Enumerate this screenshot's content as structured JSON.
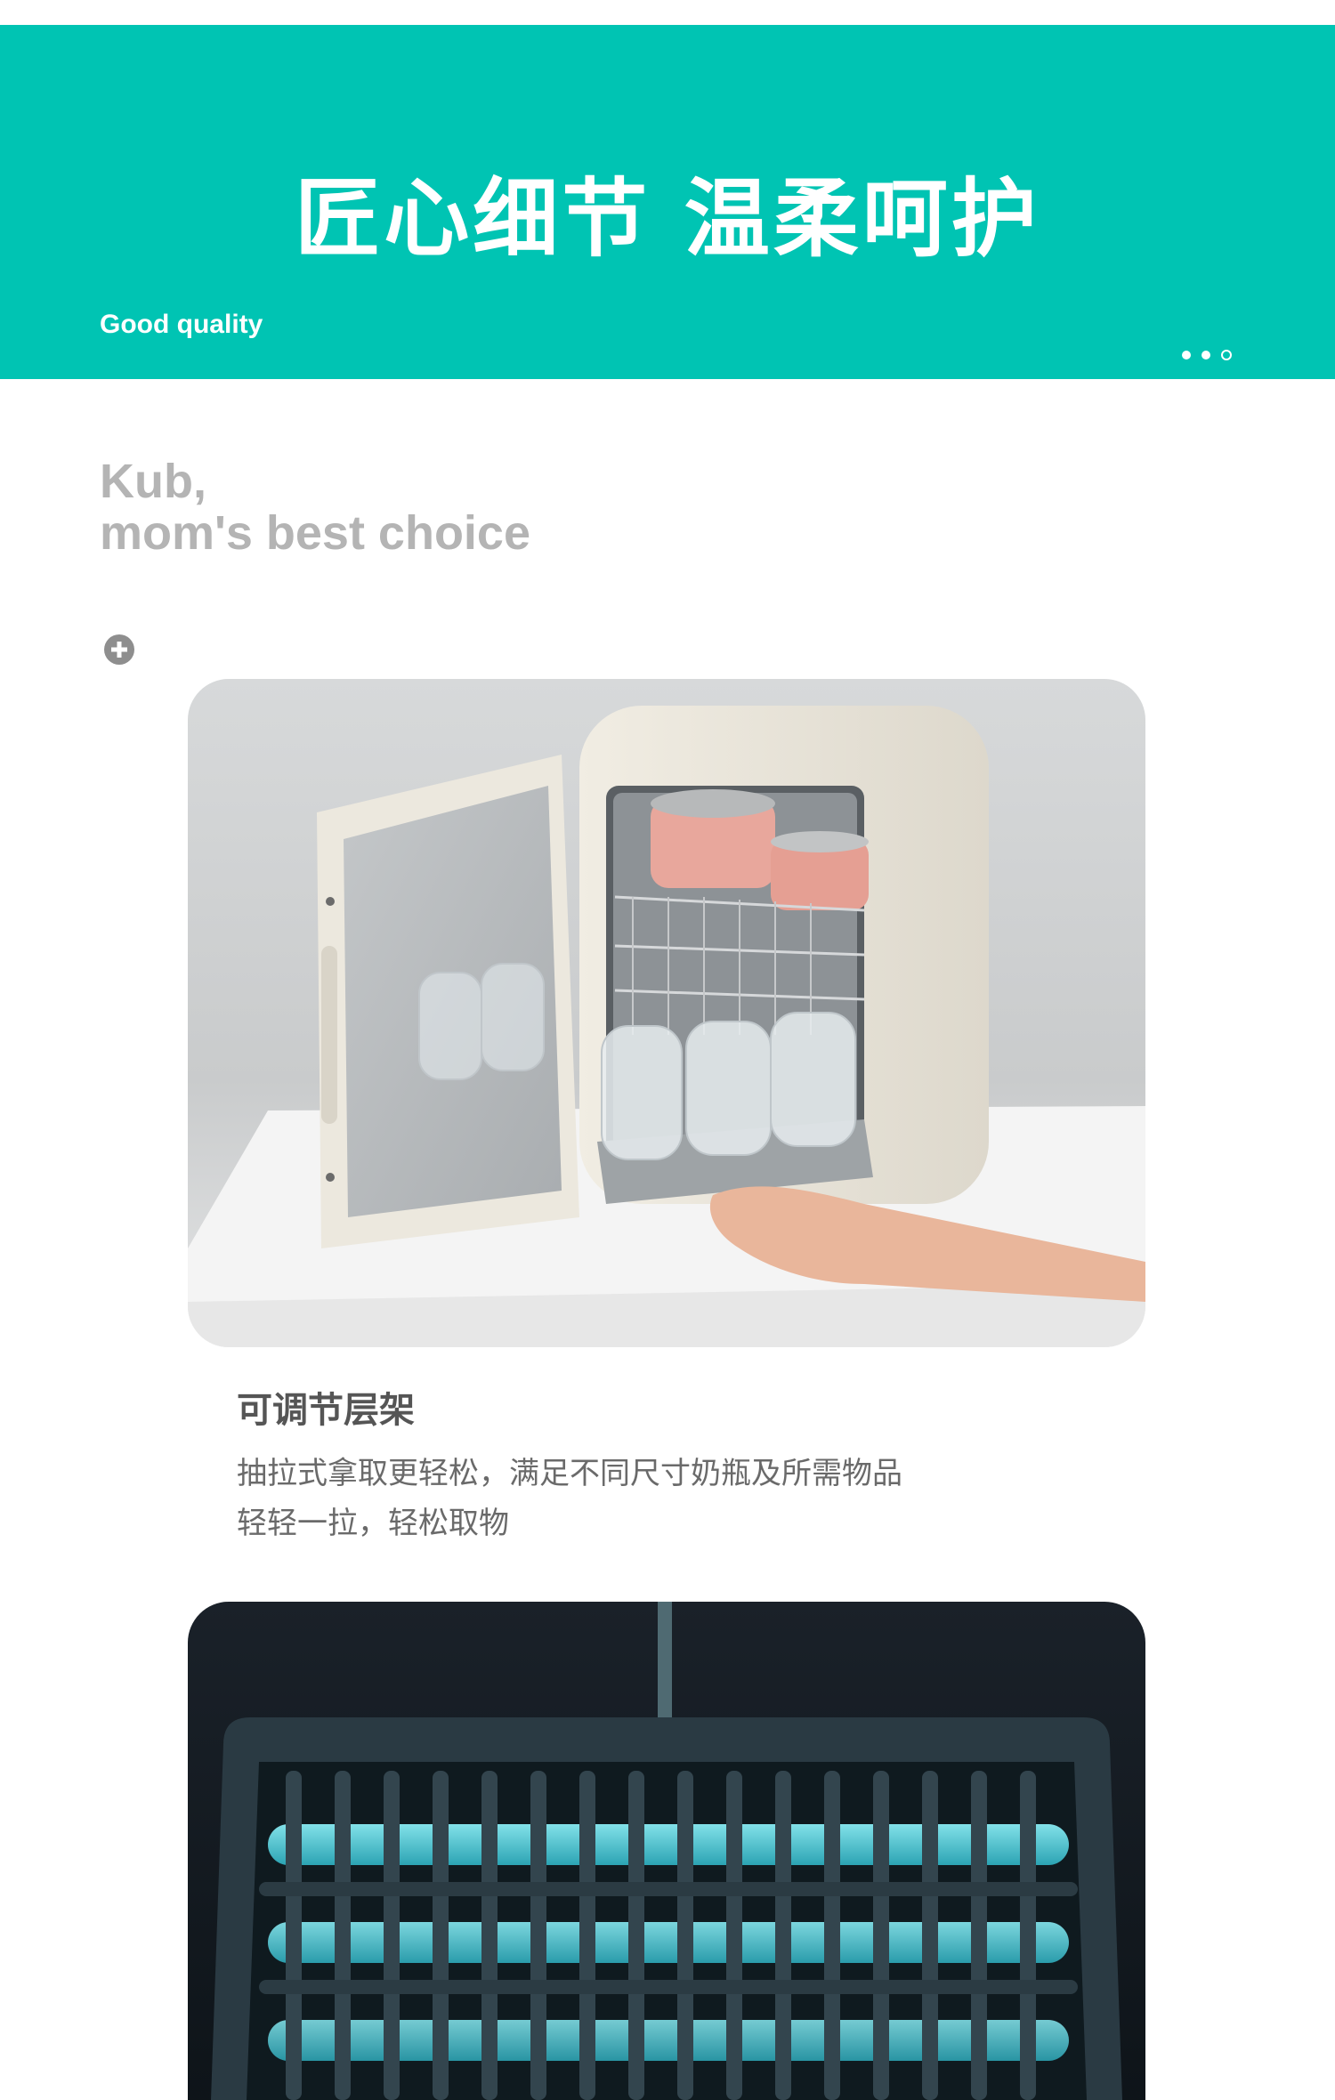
{
  "banner": {
    "title": "匠心细节 温柔呵护",
    "subtitle": "Good quality",
    "accent_color": "#00c4b3"
  },
  "slogan": {
    "line1": "Kub,",
    "line2": "mom's best choice"
  },
  "icons": {
    "expand": "plus-circle-icon"
  },
  "feature": {
    "title": "可调节层架",
    "desc_line1": "抽拉式拿取更轻松，满足不同尺寸奶瓶及所需物品",
    "desc_line2": "轻轻一拉，轻松取物"
  }
}
